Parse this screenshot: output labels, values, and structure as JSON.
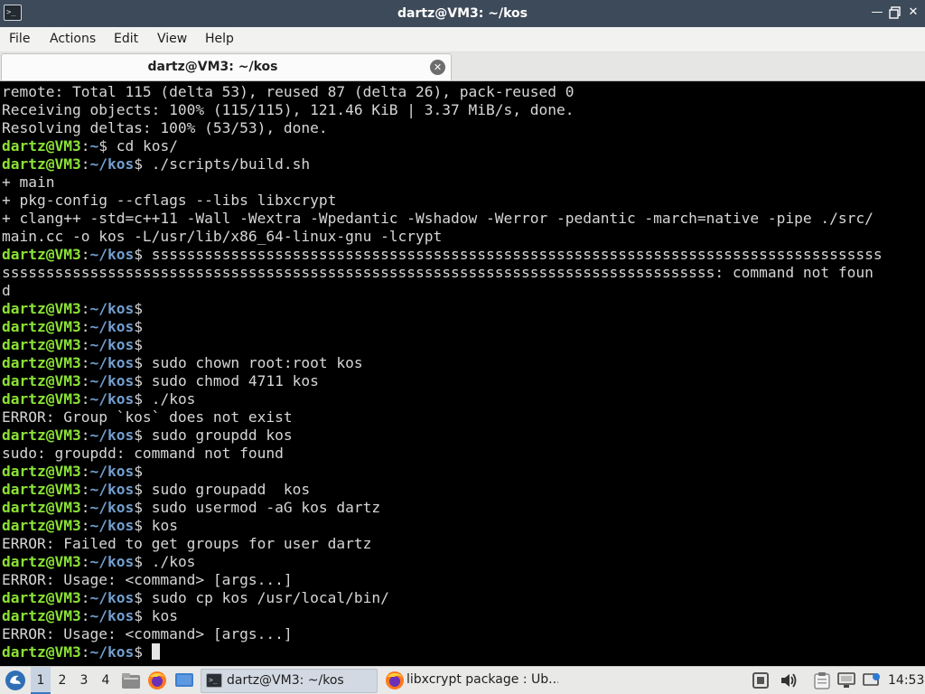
{
  "window": {
    "title": "dartz@VM3: ~/kos",
    "icon": "terminal-icon",
    "controls": [
      "minimize-icon",
      "maximize-icon",
      "close-icon"
    ]
  },
  "menubar": {
    "items": [
      "File",
      "Actions",
      "Edit",
      "View",
      "Help"
    ]
  },
  "tabs": [
    {
      "label": "dartz@VM3: ~/kos",
      "active": true
    }
  ],
  "terminal": {
    "colors": {
      "user": "#8ae234",
      "path": "#729fcf",
      "text": "#d6d6d6",
      "background": "#000000"
    },
    "prompt_user": "dartz@VM3",
    "lines": [
      {
        "t": "out",
        "text": "remote: Total 115 (delta 53), reused 87 (delta 26), pack-reused 0"
      },
      {
        "t": "out",
        "text": "Receiving objects: 100% (115/115), 121.46 KiB | 3.37 MiB/s, done."
      },
      {
        "t": "out",
        "text": "Resolving deltas: 100% (53/53), done."
      },
      {
        "t": "prompt",
        "path": "~",
        "cmd": "cd kos/"
      },
      {
        "t": "prompt",
        "path": "~/kos",
        "cmd": "./scripts/build.sh"
      },
      {
        "t": "out",
        "text": "+ main"
      },
      {
        "t": "out",
        "text": "+ pkg-config --cflags --libs libxcrypt"
      },
      {
        "t": "out",
        "text": "+ clang++ -std=c++11 -Wall -Wextra -Wpedantic -Wshadow -Werror -pedantic -march=native -pipe ./src/"
      },
      {
        "t": "out",
        "text": "main.cc -o kos -L/usr/lib/x86_64-linux-gnu -lcrypt"
      },
      {
        "t": "prompt",
        "path": "~/kos",
        "cmd": "sssssssssssssssssssssssssssssssssssssssssssssssssssssssssssssssssssssssssssssssssss"
      },
      {
        "t": "out",
        "text": "sssssssssssssssssssssssssssssssssssssssssssssssssssssssssssssssssssssssssssssssss: command not foun"
      },
      {
        "t": "out",
        "text": "d"
      },
      {
        "t": "prompt",
        "path": "~/kos",
        "cmd": ""
      },
      {
        "t": "prompt",
        "path": "~/kos",
        "cmd": ""
      },
      {
        "t": "prompt",
        "path": "~/kos",
        "cmd": ""
      },
      {
        "t": "prompt",
        "path": "~/kos",
        "cmd": "sudo chown root:root kos"
      },
      {
        "t": "prompt",
        "path": "~/kos",
        "cmd": "sudo chmod 4711 kos"
      },
      {
        "t": "prompt",
        "path": "~/kos",
        "cmd": "./kos"
      },
      {
        "t": "out",
        "text": "ERROR: Group `kos` does not exist"
      },
      {
        "t": "prompt",
        "path": "~/kos",
        "cmd": "sudo groupdd kos"
      },
      {
        "t": "out",
        "text": "sudo: groupdd: command not found"
      },
      {
        "t": "prompt",
        "path": "~/kos",
        "cmd": ""
      },
      {
        "t": "prompt",
        "path": "~/kos",
        "cmd": "sudo groupadd  kos"
      },
      {
        "t": "prompt",
        "path": "~/kos",
        "cmd": "sudo usermod -aG kos dartz"
      },
      {
        "t": "prompt",
        "path": "~/kos",
        "cmd": "kos"
      },
      {
        "t": "out",
        "text": "ERROR: Failed to get groups for user dartz"
      },
      {
        "t": "prompt",
        "path": "~/kos",
        "cmd": "./kos"
      },
      {
        "t": "out",
        "text": "ERROR: Usage: <command> [args...]"
      },
      {
        "t": "prompt",
        "path": "~/kos",
        "cmd": "sudo cp kos /usr/local/bin/"
      },
      {
        "t": "prompt",
        "path": "~/kos",
        "cmd": "kos"
      },
      {
        "t": "out",
        "text": "ERROR: Usage: <command> [args...]"
      },
      {
        "t": "prompt",
        "path": "~/kos",
        "cmd": "",
        "cursor": true
      }
    ]
  },
  "taskbar": {
    "start_icon": "start-menu-icon",
    "workspaces": [
      "1",
      "2",
      "3",
      "4"
    ],
    "active_workspace": "1",
    "quicklaunch": [
      "file-manager-icon",
      "firefox-icon",
      "show-desktop-icon"
    ],
    "tasks": [
      {
        "label": "dartz@VM3: ~/kos",
        "icon": "terminal-icon",
        "active": true
      },
      {
        "label": "libxcrypt package : Ub...",
        "icon": "firefox-icon",
        "active": false
      }
    ],
    "tray": [
      "screenshot-icon",
      "volume-icon",
      "clipboard-icon",
      "network-icon",
      "update-icon"
    ],
    "clock": "14:53"
  }
}
